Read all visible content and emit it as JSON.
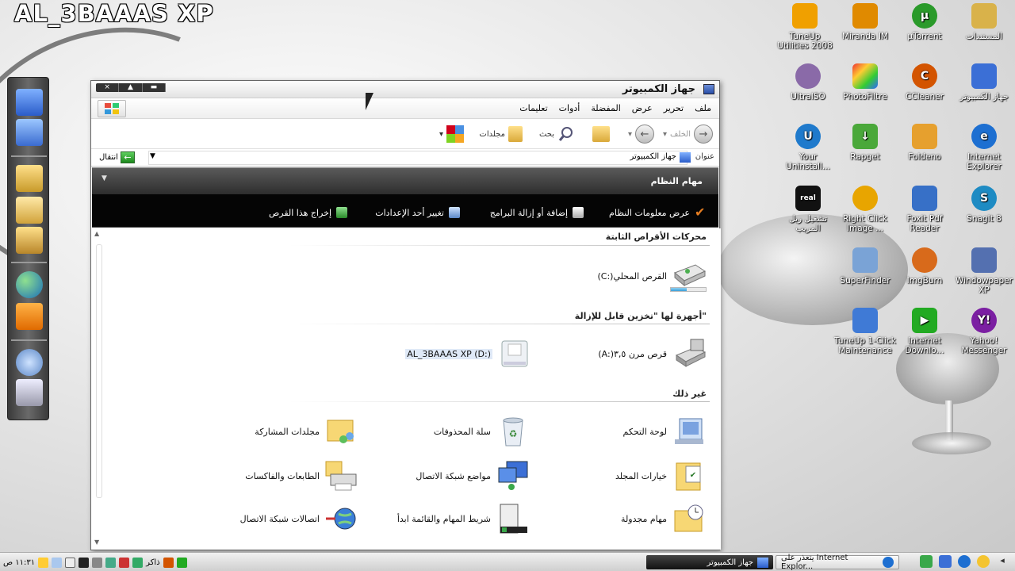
{
  "wallpaper": {
    "title": "AL_3BAAAS XP"
  },
  "desktop_icons": [
    {
      "label": "TuneUp Utilities 2008",
      "color": "#f0a000"
    },
    {
      "label": "Miranda IM",
      "color": "#e08a00"
    },
    {
      "label": "µTorrent",
      "color": "#2a9a2a"
    },
    {
      "label": "المستندات",
      "color": "#d9b24a"
    },
    {
      "label": "UltraISO",
      "color": "#8a6aa8"
    },
    {
      "label": "PhotoFiltre",
      "color": "#c0392b"
    },
    {
      "label": "CCleaner",
      "color": "#d35400"
    },
    {
      "label": "جهاز الكمبيوتر",
      "color": "#3b6fd6"
    },
    {
      "label": "Your Uninstall...",
      "color": "#1f7acc"
    },
    {
      "label": "Rapget",
      "color": "#4aa83a"
    },
    {
      "label": "Foldeno",
      "color": "#e6a02e"
    },
    {
      "label": "Internet Explorer",
      "color": "#1d6fd1"
    },
    {
      "label": "تشغيل ريل المريب",
      "color": "#111111"
    },
    {
      "label": "Right Click Image ...",
      "color": "#e8a500"
    },
    {
      "label": "Foxit Pdf Reader",
      "color": "#3770c7"
    },
    {
      "label": "SnagIt 8",
      "color": "#1e8bc3"
    },
    {
      "label": "SuperFinder",
      "color": "#7aa3d6"
    },
    {
      "label": "ImgBurn",
      "color": "#d86a1b"
    },
    {
      "label": "Windowpaper XP",
      "color": "#5470b0"
    },
    {
      "label": "TuneUp 1-Click Maintenance",
      "color": "#3f7ad6"
    },
    {
      "label": "Internet Downlo...",
      "color": "#22aa22"
    },
    {
      "label": "Yahoo! Messenger",
      "color": "#7b1fa2"
    }
  ],
  "window": {
    "title": "جهاز الكمبيوتر",
    "menu": [
      "ملف",
      "تحرير",
      "عرض",
      "المفضلة",
      "أدوات",
      "تعليمات"
    ],
    "toolbar": {
      "back": "الخلف",
      "search": "بحث",
      "folders": "مجلدات"
    },
    "address": {
      "label": "عنوان",
      "value": "جهاز الكمبيوتر",
      "go": "انتقال"
    },
    "task_pane": {
      "title": "مهام النظام",
      "tasks": [
        "عرض معلومات النظام",
        "إضافة أو إزالة البرامج",
        "تغيير أحد الإعدادات",
        "إخراج هذا القرص"
      ]
    },
    "sections": {
      "fixed": "محركات الأقراص الثابتة",
      "removable": "أجهزة لها \"تخزين قابل للإزالة\"",
      "other": "غير ذلك"
    },
    "drives": {
      "local": "(C:)القرص المحلي",
      "floppy": "(A:)قرص مرن ٣,٥",
      "cd": "AL_3BAAAS XP (D:)"
    },
    "local_disk_usage": 0.45,
    "other_items": [
      "لوحة التحكم",
      "سلة المحذوفات",
      "مجلدات المشاركة",
      "خيارات المجلد",
      "مواضع شبكة الاتصال",
      "الطابعات والفاكسات",
      "مهام مجدولة",
      "شريط المهام والقائمة ابدأ",
      "اتصالات شبكة الاتصال"
    ]
  },
  "taskbar": {
    "active_window": "جهاز الكمبيوتر",
    "other_window": "يتعذر على Internet Explor...",
    "clock": "١١:٣١ ص",
    "language": "ذاكر"
  },
  "colors": {
    "task_pane_bg": "#050505",
    "accent": "#3b6fd6"
  }
}
